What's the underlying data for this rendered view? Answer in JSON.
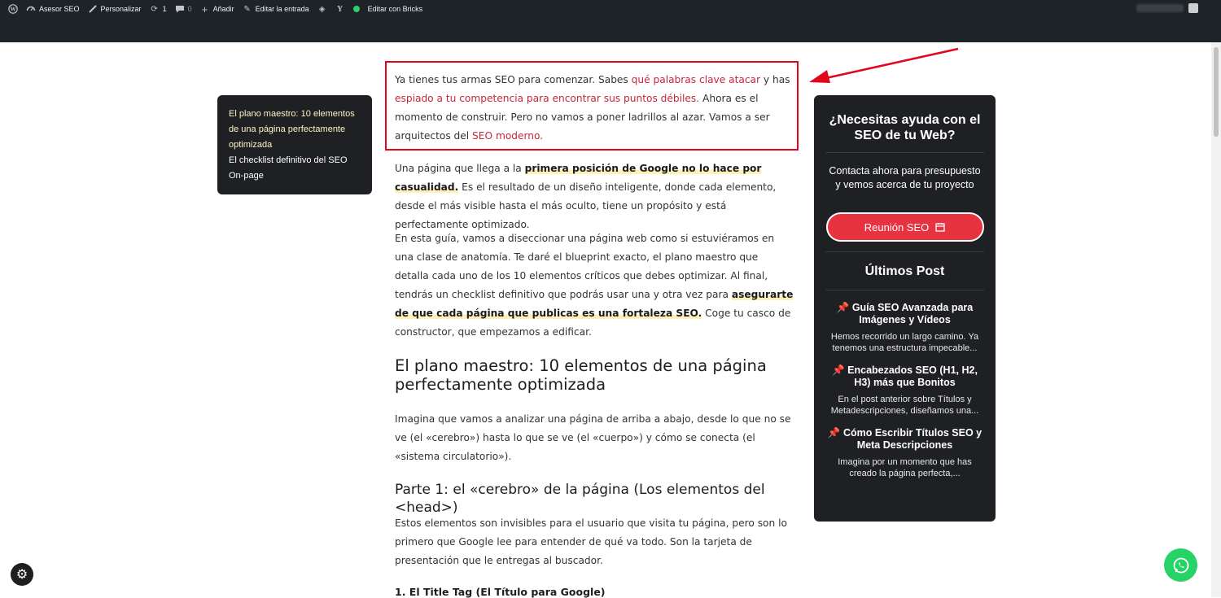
{
  "adminbar": {
    "items": [
      {
        "icon": "wordpress-icon",
        "label": ""
      },
      {
        "icon": "gauge-icon",
        "label": "Asesor SEO"
      },
      {
        "icon": "brush-icon",
        "label": "Personalizar"
      },
      {
        "icon": "refresh-icon",
        "label": "1"
      },
      {
        "icon": "comment-icon",
        "label": "0"
      },
      {
        "icon": "plus-icon",
        "label": "Añadir"
      },
      {
        "icon": "pencil-icon",
        "label": "Editar la entrada"
      },
      {
        "icon": "diamond-icon",
        "label": ""
      },
      {
        "icon": "yoast-icon",
        "label": ""
      },
      {
        "icon": "status-dot-icon",
        "label": "Editar con Bricks"
      }
    ]
  },
  "toc": {
    "item1": "El plano maestro: 10 elementos de una página perfectamente optimizada",
    "item2": "El checklist definitivo del SEO On-page"
  },
  "article": {
    "p1": {
      "t1": "Ya tienes tus armas SEO para comenzar. Sabes ",
      "link1": "qué palabras clave atacar",
      "t2": " y has ",
      "link2": "espiado a tu competencia para encontrar sus puntos débiles.",
      "t3": " Ahora es el momento de construir. Pero no vamos a poner ladrillos al azar. Vamos a ser arquitectos del ",
      "link3": "SEO moderno."
    },
    "p2": {
      "t1": "Una página que llega a la ",
      "hl1": "primera posición de Google no lo hace por casualidad.",
      "t2": " Es el resultado de un diseño inteligente, donde cada elemento, desde el más visible hasta el más oculto, tiene un propósito y está perfectamente optimizado."
    },
    "p3": {
      "t1": "En esta guía, vamos a diseccionar una página web como si estuviéramos en una clase de anatomía. Te daré el blueprint exacto, el plano maestro que detalla cada uno de los 10 elementos críticos que debes optimizar. Al final, tendrás un checklist definitivo que podrás usar una y otra vez para ",
      "hl1": "asegurarte de que cada página que publicas es una fortaleza SEO.",
      "t2": " Coge tu casco de constructor, que empezamos a edificar."
    },
    "h2": "El plano maestro: 10 elementos de una página perfectamente optimizada",
    "p4": "Imagina que vamos a analizar una página de arriba a abajo, desde lo que no se ve (el «cerebro») hasta lo que se ve (el «cuerpo») y cómo se conecta (el «sistema circulatorio»).",
    "h3": "Parte 1: el «cerebro» de la página (Los elementos del <head>)",
    "p5": "Estos elementos son invisibles para el usuario que visita tu página, pero son lo primero que Google lee para entender de qué va todo. Son la tarjeta de presentación que le entregas al buscador.",
    "h4": "1. El Title Tag (El Título para Google)"
  },
  "sidebar": {
    "title": "¿Necesitas ayuda con el SEO de tu Web?",
    "text": "Contacta ahora para presupuesto y vemos acerca de tu proyecto",
    "button": "Reunión SEO",
    "latest_title": "Últimos Post",
    "posts": [
      {
        "title": "Guía SEO Avanzada para Imágenes y Vídeos",
        "excerpt": "Hemos recorrido un largo camino. Ya tenemos una estructura impecable..."
      },
      {
        "title": "Encabezados SEO (H1, H2, H3) más que Bonitos",
        "excerpt": "En el post anterior sobre Títulos y Metadescripciones, diseñamos una..."
      },
      {
        "title": "Cómo Escribir Títulos SEO y Meta Descripciones",
        "excerpt": "Imagina por un momento que has creado la página perfecta,..."
      }
    ]
  },
  "colors": {
    "accent": "#e7323f",
    "link": "#c5273a",
    "highlight": "#fdf0b8",
    "annotation": "#e1061c",
    "whatsapp": "#25d366"
  }
}
